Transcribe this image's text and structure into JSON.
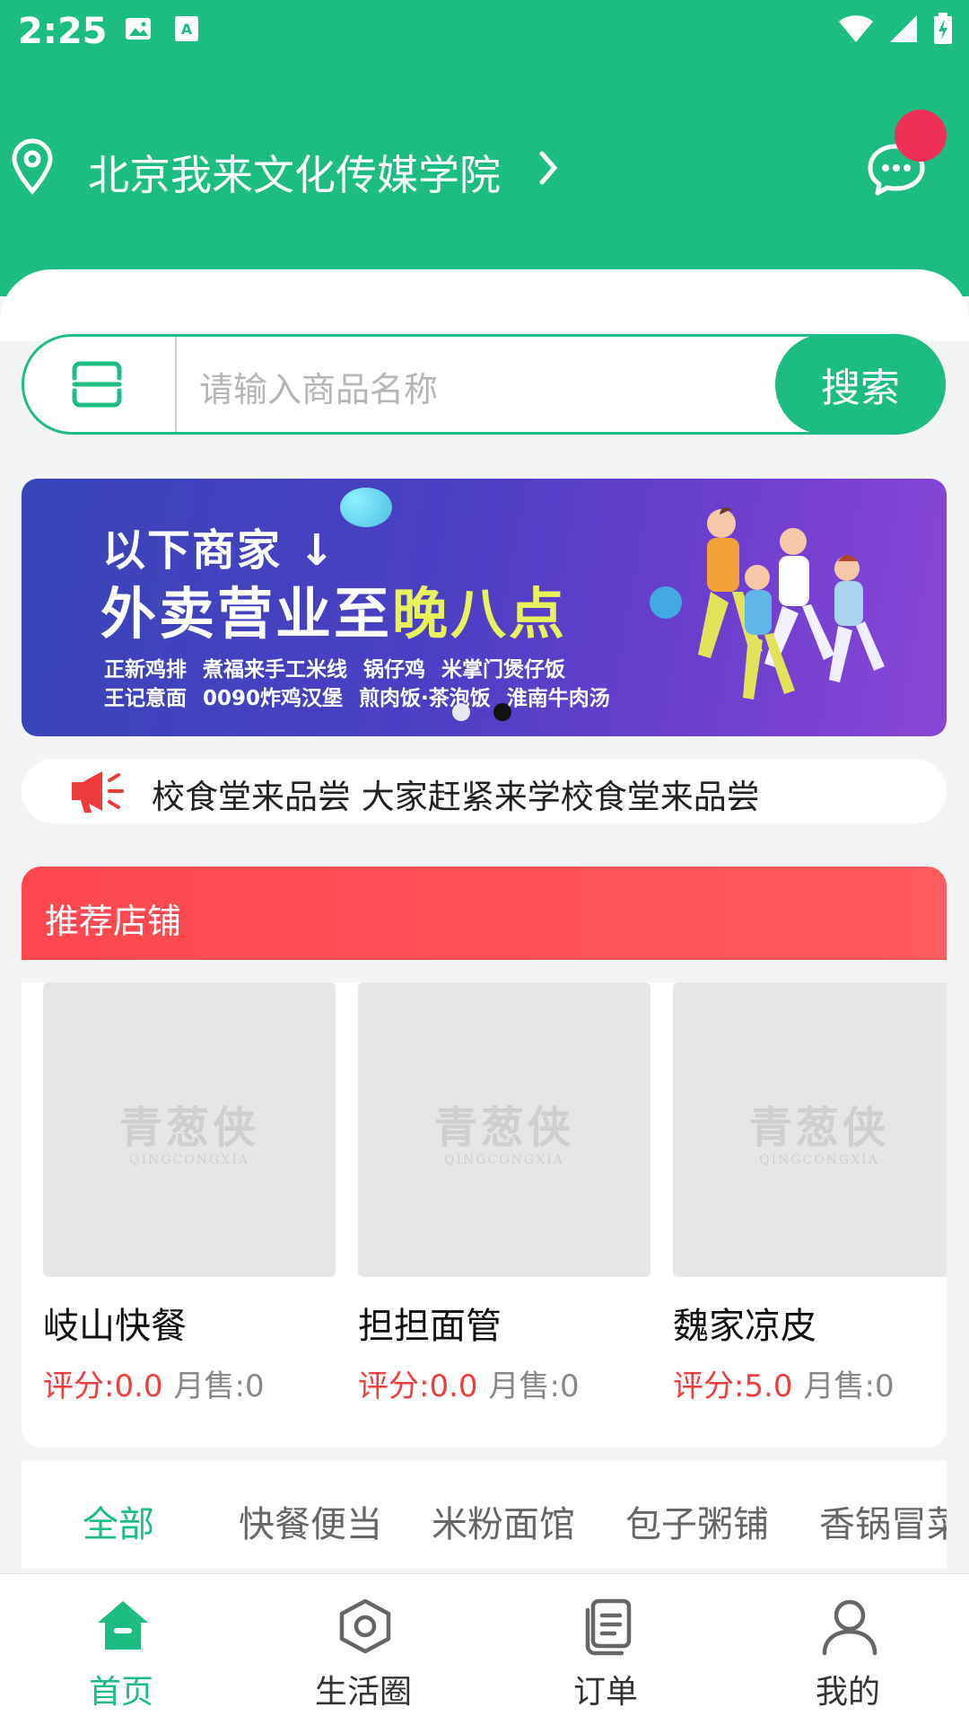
{
  "status_bar": {
    "time": "2:25",
    "icons_left": [
      "image-icon",
      "text-a-icon"
    ],
    "icons_right": [
      "wifi-icon",
      "signal-icon",
      "battery-charging-icon"
    ]
  },
  "header": {
    "location": "北京我来文化传媒学院",
    "accent_color": "#1dbc82",
    "badge_color": "#ef2f55"
  },
  "search": {
    "placeholder": "请输入商品名称",
    "button_label": "搜索"
  },
  "banner": {
    "line1": "以下商家",
    "line2_prefix": "外卖营业至",
    "line2_highlight": "晚八点",
    "shops_line1": "正新鸡排 煮福来手工米线 锅仔鸡 米掌门煲仔饭",
    "shops_line2": "王记意面 0090炸鸡汉堡 煎肉饭·茶泡饭 淮南牛肉汤",
    "page_count": 2,
    "active_page": 2
  },
  "notice": {
    "text": "校食堂来品尝 大家赶紧来学校食堂来品尝"
  },
  "recommended": {
    "title": "推荐店铺",
    "watermark_main": "青葱侠",
    "watermark_sub": "QINGCONGXIA",
    "shops": [
      {
        "name": "岐山快餐",
        "rating": "评分:0.0",
        "sales": "月售:0"
      },
      {
        "name": "担担面管",
        "rating": "评分:0.0",
        "sales": "月售:0"
      },
      {
        "name": "魏家凉皮",
        "rating": "评分:5.0",
        "sales": "月售:0"
      }
    ]
  },
  "categories": [
    "全部",
    "快餐便当",
    "米粉面馆",
    "包子粥铺",
    "香锅冒菜"
  ],
  "tabbar": [
    {
      "label": "首页",
      "icon": "home-icon"
    },
    {
      "label": "生活圈",
      "icon": "hexagon-icon"
    },
    {
      "label": "订单",
      "icon": "orders-icon"
    },
    {
      "label": "我的",
      "icon": "profile-icon"
    }
  ]
}
